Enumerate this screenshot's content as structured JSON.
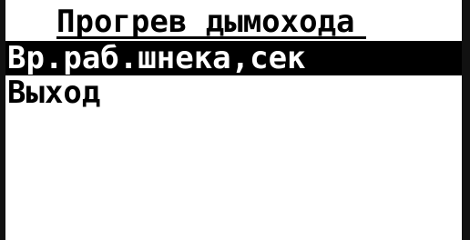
{
  "screen": {
    "title": "Прогрев дымохода",
    "menu": [
      {
        "label": "Вр.раб.шнека,сек",
        "selected": true
      },
      {
        "label": "Выход",
        "selected": false
      }
    ]
  },
  "colors": {
    "background": "#ffffff",
    "foreground": "#000000",
    "selected_background": "#000000",
    "selected_foreground": "#ffffff"
  }
}
